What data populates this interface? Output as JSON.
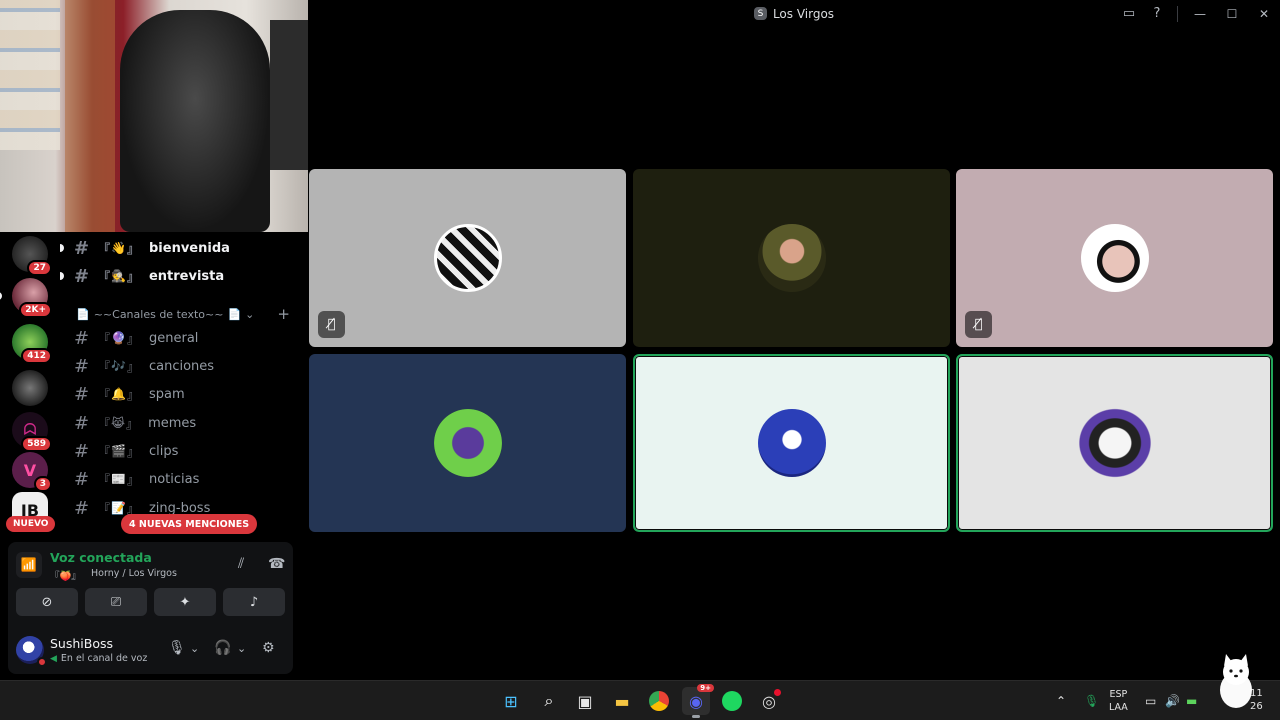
{
  "window": {
    "title": "Los Virgos",
    "server_initial": "S"
  },
  "rail": {
    "servers": [
      {
        "name": "server-1",
        "badge": "27",
        "color": "#2a2a2a"
      },
      {
        "name": "server-2",
        "badge": "2K+",
        "color": "#6b2a3a"
      },
      {
        "name": "server-3",
        "badge": "412",
        "color": "#2d7a2d"
      },
      {
        "name": "server-4",
        "badge": "",
        "color": "#3a3a3a"
      },
      {
        "name": "server-5",
        "badge": "589",
        "color": "#b0236a"
      },
      {
        "name": "server-6",
        "badge": "3",
        "color": "#5b1e4a"
      },
      {
        "name": "server-7",
        "badge": "",
        "color": "#f0f0f0"
      }
    ],
    "new_label": "NUEVO"
  },
  "channels": {
    "top": [
      {
        "name": "bienvenida",
        "emoji": "👋"
      },
      {
        "name": "entrevista",
        "emoji": "🕵"
      }
    ],
    "category": "~~Canales de texto~~",
    "list": [
      {
        "name": "general",
        "emoji": "🔮"
      },
      {
        "name": "canciones",
        "emoji": "🎶"
      },
      {
        "name": "spam",
        "emoji": "🔔"
      },
      {
        "name": "memes",
        "emoji": "😹"
      },
      {
        "name": "clips",
        "emoji": "🎬"
      },
      {
        "name": "noticias",
        "emoji": "📰"
      },
      {
        "name": "zing-boss",
        "emoji": "📝"
      }
    ],
    "mentions_label": "4 NUEVAS MENCIONES"
  },
  "voice": {
    "title": "Voz conectada",
    "channel": "Horny / Los Virgos"
  },
  "user": {
    "name": "SushiBoss",
    "status": "En el canal de voz"
  },
  "tiles": [
    {
      "name": "participant-1",
      "bg": "#b4b4b4",
      "muted": true,
      "speaking": false
    },
    {
      "name": "participant-2",
      "bg": "#1e1f0f",
      "muted": false,
      "speaking": false
    },
    {
      "name": "participant-3",
      "bg": "#c2acb1",
      "muted": true,
      "speaking": false
    },
    {
      "name": "participant-4",
      "bg": "#243554",
      "muted": false,
      "speaking": false
    },
    {
      "name": "participant-5",
      "bg": "#e9f4f1",
      "muted": false,
      "speaking": true
    },
    {
      "name": "participant-6",
      "bg": "#e4e4e4",
      "muted": false,
      "speaking": true
    }
  ],
  "taskbar": {
    "discord_badge": "9+",
    "lang_top": "ESP",
    "lang_bottom": "LAA",
    "clock_top": "11",
    "clock_bottom": "26"
  },
  "colors": {
    "accent_green": "#23a55a",
    "mention_red": "#da373c"
  }
}
